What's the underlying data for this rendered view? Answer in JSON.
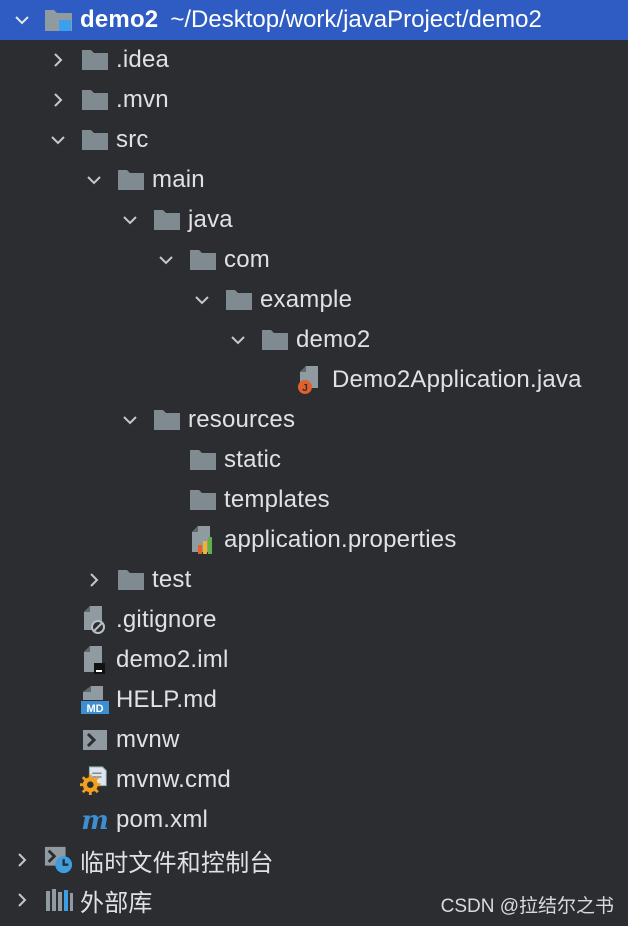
{
  "tree": {
    "root": {
      "label": "demo2",
      "path": "~/Desktop/work/javaProject/demo2"
    },
    "items": [
      {
        "label": ".idea"
      },
      {
        "label": ".mvn"
      },
      {
        "label": "src"
      },
      {
        "label": "main"
      },
      {
        "label": "java"
      },
      {
        "label": "com"
      },
      {
        "label": "example"
      },
      {
        "label": "demo2"
      },
      {
        "label": "Demo2Application.java"
      },
      {
        "label": "resources"
      },
      {
        "label": "static"
      },
      {
        "label": "templates"
      },
      {
        "label": "application.properties"
      },
      {
        "label": "test"
      },
      {
        "label": ".gitignore"
      },
      {
        "label": "demo2.iml"
      },
      {
        "label": "HELP.md"
      },
      {
        "label": "mvnw"
      },
      {
        "label": "mvnw.cmd"
      },
      {
        "label": "pom.xml"
      },
      {
        "label": "临时文件和控制台"
      },
      {
        "label": "外部库"
      }
    ]
  },
  "watermark": "CSDN @拉结尔之书",
  "icons": {
    "folder": "folder-icon",
    "module": "module-folder-icon",
    "java": "java-class-icon",
    "properties": "properties-file-icon",
    "ignore": "gitignore-file-icon",
    "iml": "iml-file-icon",
    "md": "markdown-file-icon",
    "shell": "shell-script-icon",
    "cmd": "cmd-script-icon",
    "maven": "maven-icon",
    "scratches": "scratches-icon",
    "libraries": "libraries-icon"
  },
  "colors": {
    "background": "#2b2d30",
    "selection": "#2e5cc2",
    "folder": "#7f8b91",
    "text": "#dfe1e5"
  }
}
